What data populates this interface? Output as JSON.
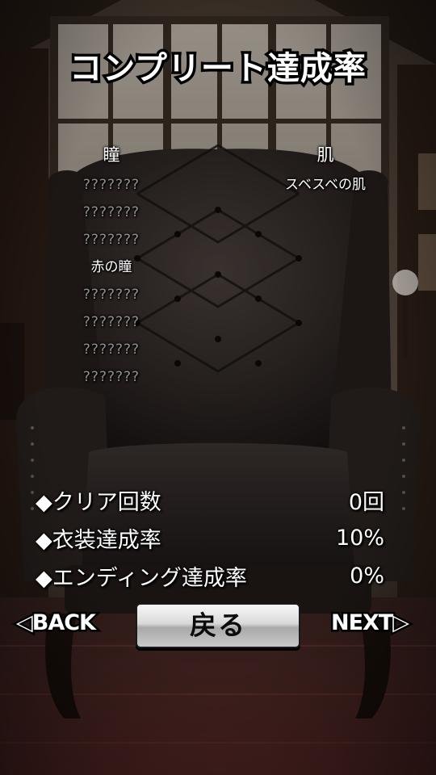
{
  "title": "コンプリート達成率",
  "left_column": {
    "heading": "瞳",
    "items": [
      "???????",
      "???????",
      "???????",
      "赤の瞳",
      "???????",
      "???????",
      "???????",
      "???????"
    ]
  },
  "right_column": {
    "heading": "肌",
    "items": [
      "スベスベの肌"
    ]
  },
  "stats": [
    {
      "label": "◆クリア回数",
      "value": "0回"
    },
    {
      "label": "◆衣装達成率",
      "value": "10%"
    },
    {
      "label": "◆エンディング達成率",
      "value": "0%"
    }
  ],
  "nav": {
    "back_label": "◁BACK",
    "return_label": "戻る",
    "next_label": "NEXT▷"
  }
}
